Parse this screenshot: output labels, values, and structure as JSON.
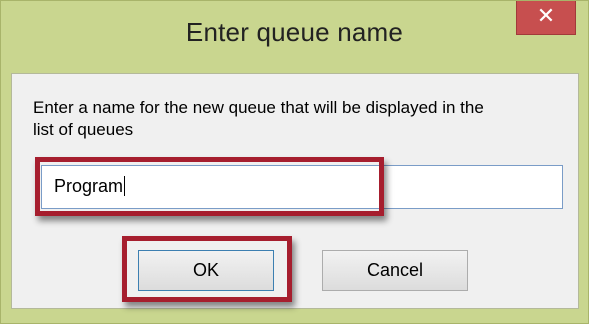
{
  "window": {
    "title": "Enter queue name",
    "close_icon": "close-icon",
    "close_glyph": "✕"
  },
  "dialog": {
    "prompt": "Enter a name for the new queue that will be displayed in the list of queues",
    "input": {
      "value": "Program"
    },
    "buttons": {
      "ok_label": "OK",
      "cancel_label": "Cancel"
    }
  },
  "annotations": {
    "highlight_color": "#a61e2e"
  },
  "colors": {
    "titlebar": "#c9d68f",
    "close_button": "#c74f4f",
    "client_background": "#f0f0f0"
  }
}
